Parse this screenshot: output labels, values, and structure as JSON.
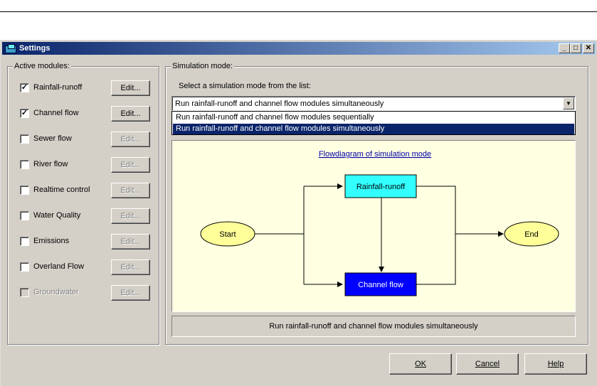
{
  "window": {
    "title": "Settings",
    "controls": {
      "minimize": "_",
      "maximize": "□",
      "close": "✕"
    }
  },
  "active_modules": {
    "label": "Active modules:",
    "edit_label": "Edit...",
    "items": [
      {
        "label": "Rainfall-runoff",
        "checked": true,
        "enabled": true,
        "edit_enabled": true
      },
      {
        "label": "Channel flow",
        "checked": true,
        "enabled": true,
        "edit_enabled": true
      },
      {
        "label": "Sewer flow",
        "checked": false,
        "enabled": true,
        "edit_enabled": false
      },
      {
        "label": "River flow",
        "checked": false,
        "enabled": true,
        "edit_enabled": false
      },
      {
        "label": "Realtime control",
        "checked": false,
        "enabled": true,
        "edit_enabled": false
      },
      {
        "label": "Water Quality",
        "checked": false,
        "enabled": true,
        "edit_enabled": false
      },
      {
        "label": "Emissions",
        "checked": false,
        "enabled": true,
        "edit_enabled": false
      },
      {
        "label": "Overland Flow",
        "checked": false,
        "enabled": true,
        "edit_enabled": false
      },
      {
        "label": "Groundwater",
        "checked": false,
        "enabled": false,
        "edit_enabled": false
      }
    ]
  },
  "simulation_mode": {
    "label": "Simulation mode:",
    "select_label": "Select a simulation mode from the list:",
    "selected": "Run rainfall-runoff and channel flow modules simultaneously",
    "options": [
      "Run rainfall-runoff and channel flow modules sequentially",
      "Run rainfall-runoff and channel flow modules simultaneously"
    ],
    "highlighted_index": 1,
    "description": "Run rainfall-runoff and channel flow modules simultaneously"
  },
  "flow_diagram": {
    "title": "Flowdiagram of simulation mode",
    "start": "Start",
    "end": "End",
    "rainfall": "Rainfall-runoff",
    "channel": "Channel flow",
    "colors": {
      "ellipse": "#ffff99",
      "rainfall_box": "#33ffff",
      "channel_box": "#0000ff",
      "title_link": "#0000aa"
    }
  },
  "buttons": {
    "ok": "OK",
    "cancel": "Cancel",
    "help": "Help"
  },
  "colors": {
    "face": "#d4d0c8",
    "titlebar": "#0a246a",
    "selection": "#0a246a"
  }
}
